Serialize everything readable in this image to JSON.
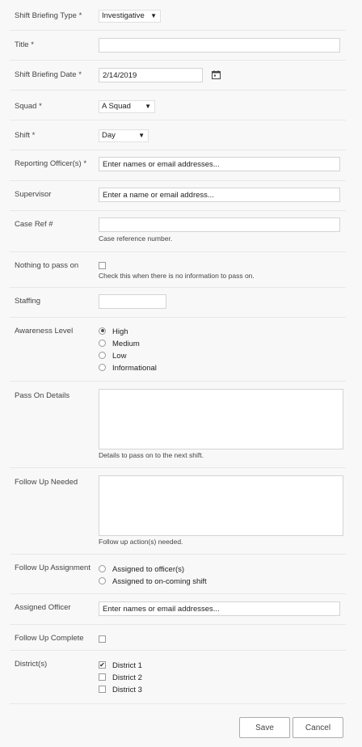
{
  "form": {
    "briefing_type": {
      "label": "Shift Briefing Type *",
      "value": "Investigative"
    },
    "title": {
      "label": "Title *",
      "value": ""
    },
    "briefing_date": {
      "label": "Shift Briefing Date *",
      "value": "2/14/2019"
    },
    "squad": {
      "label": "Squad *",
      "value": "A Squad"
    },
    "shift": {
      "label": "Shift *",
      "value": "Day"
    },
    "reporting_officers": {
      "label": "Reporting Officer(s) *",
      "placeholder": "Enter names or email addresses..."
    },
    "supervisor": {
      "label": "Supervisor",
      "placeholder": "Enter a name or email address..."
    },
    "case_ref": {
      "label": "Case Ref #",
      "value": "",
      "hint": "Case reference number."
    },
    "nothing_to_pass": {
      "label": "Nothing to pass on",
      "checked": false,
      "hint": "Check this when there is no information to pass on."
    },
    "staffing": {
      "label": "Staffing",
      "value": ""
    },
    "awareness": {
      "label": "Awareness Level",
      "options": [
        {
          "label": "High",
          "selected": true
        },
        {
          "label": "Medium",
          "selected": false
        },
        {
          "label": "Low",
          "selected": false
        },
        {
          "label": "Informational",
          "selected": false
        }
      ]
    },
    "pass_on_details": {
      "label": "Pass On Details",
      "hint": "Details to pass on to the next shift."
    },
    "follow_up_needed": {
      "label": "Follow Up Needed",
      "hint": "Follow up action(s) needed."
    },
    "follow_up_assignment": {
      "label": "Follow Up Assignment",
      "options": [
        {
          "label": "Assigned to officer(s)",
          "selected": false
        },
        {
          "label": "Assigned to on-coming shift",
          "selected": false
        }
      ]
    },
    "assigned_officer": {
      "label": "Assigned Officer",
      "placeholder": "Enter names or email addresses..."
    },
    "follow_up_complete": {
      "label": "Follow Up Complete",
      "checked": false
    },
    "districts": {
      "label": "District(s)",
      "options": [
        {
          "label": "District 1",
          "checked": true
        },
        {
          "label": "District 2",
          "checked": false
        },
        {
          "label": "District 3",
          "checked": false
        }
      ]
    }
  },
  "buttons": {
    "save": "Save",
    "cancel": "Cancel"
  },
  "icons": {
    "calendar": "calendar-icon",
    "dropdown": "chevron-down-icon",
    "checkmark": "checkmark-icon"
  }
}
